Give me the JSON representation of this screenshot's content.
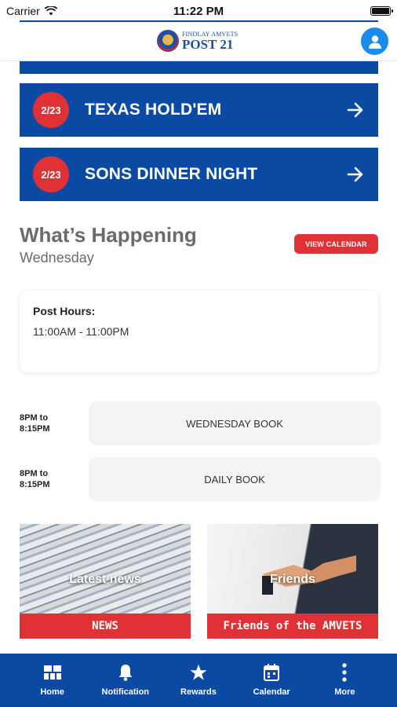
{
  "status_bar": {
    "carrier": "Carrier",
    "time": "11:22 PM",
    "battery_level": 1.0
  },
  "header": {
    "logo_line1": "FINDLAY AMVETS",
    "logo_line2": "POST 21"
  },
  "events": [
    {
      "date": "2/23",
      "title": "TEXAS HOLD'EM"
    },
    {
      "date": "2/23",
      "title": "SONS DINNER NIGHT"
    }
  ],
  "happening": {
    "title": "What’s Happening",
    "day": "Wednesday",
    "view_calendar_label": "VIEW CALENDAR",
    "hours_label": "Post Hours:",
    "hours_value": "11:00AM - 11:00PM"
  },
  "schedule": [
    {
      "time_line1": "8PM to",
      "time_line2": "8:15PM",
      "name": "WEDNESDAY BOOK"
    },
    {
      "time_line1": "8PM to",
      "time_line2": "8:15PM",
      "name": "DAILY BOOK"
    }
  ],
  "tiles": [
    {
      "overlay": "Latest news",
      "caption": "NEWS"
    },
    {
      "overlay": "Friends",
      "caption": "Friends of the AMVETS"
    }
  ],
  "tab_bar": [
    {
      "label": "Home",
      "icon": "grid-icon"
    },
    {
      "label": "Notification",
      "icon": "bell-icon"
    },
    {
      "label": "Rewards",
      "icon": "star-icon"
    },
    {
      "label": "Calendar",
      "icon": "calendar-icon"
    },
    {
      "label": "More",
      "icon": "more-vertical-icon"
    }
  ],
  "colors": {
    "primary_blue": "#0a4aa3",
    "accent_red": "#e03136",
    "profile_blue": "#1a8cf0"
  }
}
